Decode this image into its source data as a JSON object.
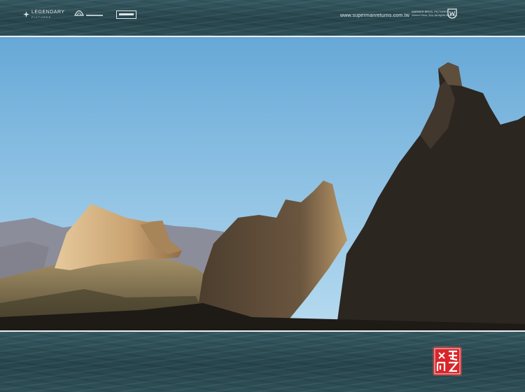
{
  "header": {
    "logos": [
      {
        "name": "legendary-pictures",
        "text": "LEGENDARY",
        "subtext": "PICTURES"
      },
      {
        "name": "dc-comics-logo",
        "text": ""
      },
      {
        "name": "studio-logo",
        "text": ""
      }
    ],
    "website": "www.supermanreturns.com.tw",
    "credit_lines": [
      "WARNER BROS. PICTURES",
      "Warner Bros. Ent. All rights reserved."
    ]
  },
  "photo": {
    "subject": "desert fortress ruins silhouetted against a clear blue sky",
    "colors": {
      "sky_top": "#6aaad8",
      "sky_bottom": "#b3d8ee",
      "mountains": "#8c8c99",
      "sunlit_rock": "#d6b585",
      "shadow_rock": "#2a2520",
      "ground": "#8a7a55"
    }
  },
  "footer": {
    "seal_color": "#d8262a",
    "seal_icon": "chinese-seal-stamp-icon"
  }
}
